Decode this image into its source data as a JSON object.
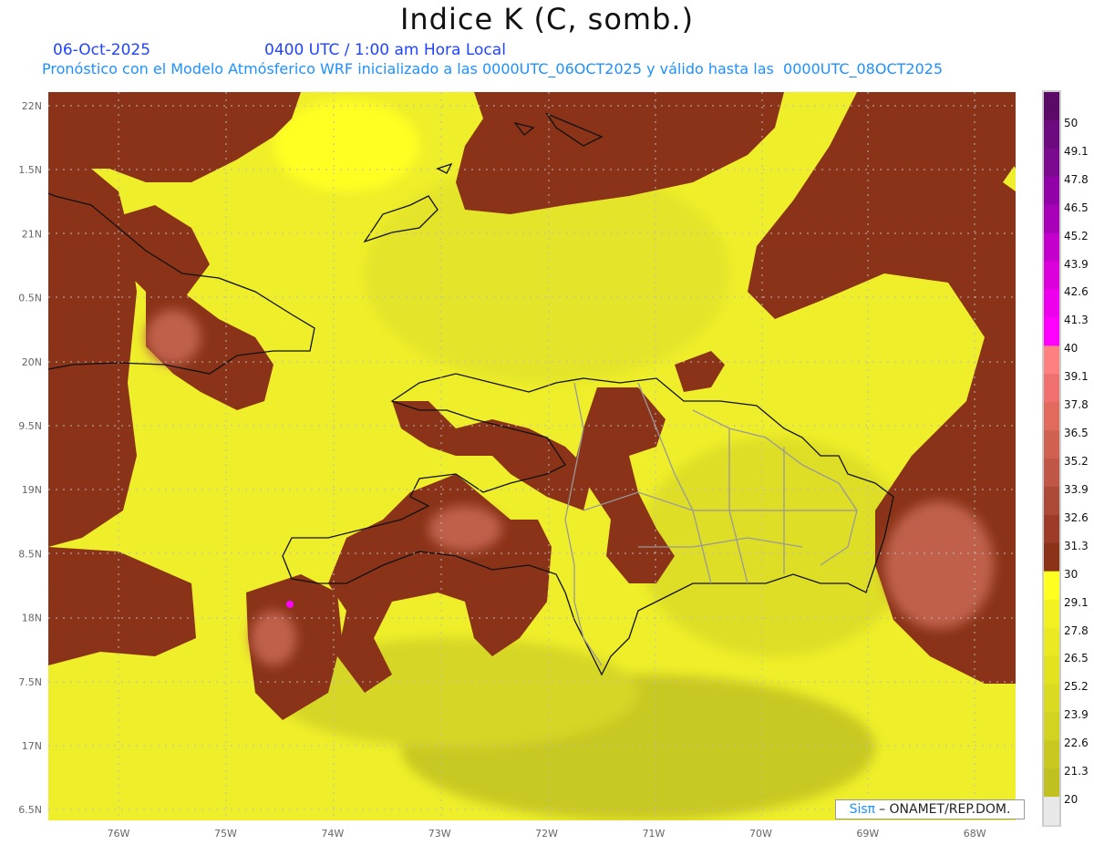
{
  "title": "Indice K (C, somb.)",
  "date": "06-Oct-2025",
  "time": "0400 UTC / 1:00 am Hora Local",
  "description": "Pronóstico con el Modelo Atmósferico WRF inicializado a las 0000UTC_06OCT2025 y válido hasta las  0000UTC_08OCT2025",
  "credit": {
    "brand": "Sisπ",
    "text": "– ONAMET/REP.DOM."
  },
  "lat_labels": [
    "22N",
    "1.5N",
    "21N",
    "0.5N",
    "20N",
    "9.5N",
    "19N",
    "8.5N",
    "18N",
    "7.5N",
    "17N",
    "6.5N"
  ],
  "lon_labels": [
    "76W",
    "75W",
    "74W",
    "73W",
    "72W",
    "71W",
    "70W",
    "69W",
    "68W"
  ],
  "colorbar": {
    "labels": [
      "50",
      "49.1",
      "47.8",
      "46.5",
      "45.2",
      "43.9",
      "42.6",
      "41.3",
      "40",
      "39.1",
      "37.8",
      "36.5",
      "35.2",
      "33.9",
      "32.6",
      "31.3",
      "30",
      "29.1",
      "27.8",
      "26.5",
      "25.2",
      "23.9",
      "22.6",
      "21.3",
      "20"
    ],
    "colors": [
      "#5c0a68",
      "#6e0a80",
      "#7c0a90",
      "#9200a8",
      "#a800b8",
      "#c400cc",
      "#dc00dc",
      "#ee00ee",
      "#ff00ff",
      "#ff8080",
      "#f07070",
      "#e06a5c",
      "#d06050",
      "#c05646",
      "#ac4a38",
      "#9c3c28",
      "#8a3318",
      "#ffff20",
      "#f2f220",
      "#eaea20",
      "#e2e220",
      "#dada20",
      "#d2d220",
      "#c8c820",
      "#c0c020",
      "#e8e8e8"
    ]
  },
  "colors": {
    "high": "#8a3318",
    "mid": "#b45a44",
    "low": "#ffff20",
    "low2": "#e6e630"
  }
}
